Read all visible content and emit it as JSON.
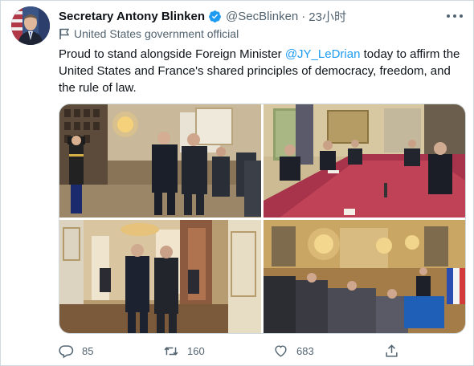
{
  "author": {
    "name": "Secretary Antony Blinken",
    "handle": "@SecBlinken",
    "separator": "·",
    "time": "23小时",
    "label": "United States government official"
  },
  "tweet": {
    "text_before": "Proud to stand alongside Foreign Minister ",
    "mention": "@JY_LeDrian",
    "text_after": " today to affirm the United States and France's shared principles of democracy, freedom, and the rule of law."
  },
  "stats": {
    "replies": "85",
    "retweets": "160",
    "likes": "683"
  },
  "icons": {
    "verified": "verified-badge-icon",
    "more": "more-icon",
    "label": "flag-icon",
    "reply": "reply-icon",
    "retweet": "retweet-icon",
    "like": "heart-icon",
    "share": "share-icon"
  },
  "colors": {
    "accent": "#1d9bf0",
    "secondary_text": "#536471",
    "border": "#cfd9de"
  }
}
